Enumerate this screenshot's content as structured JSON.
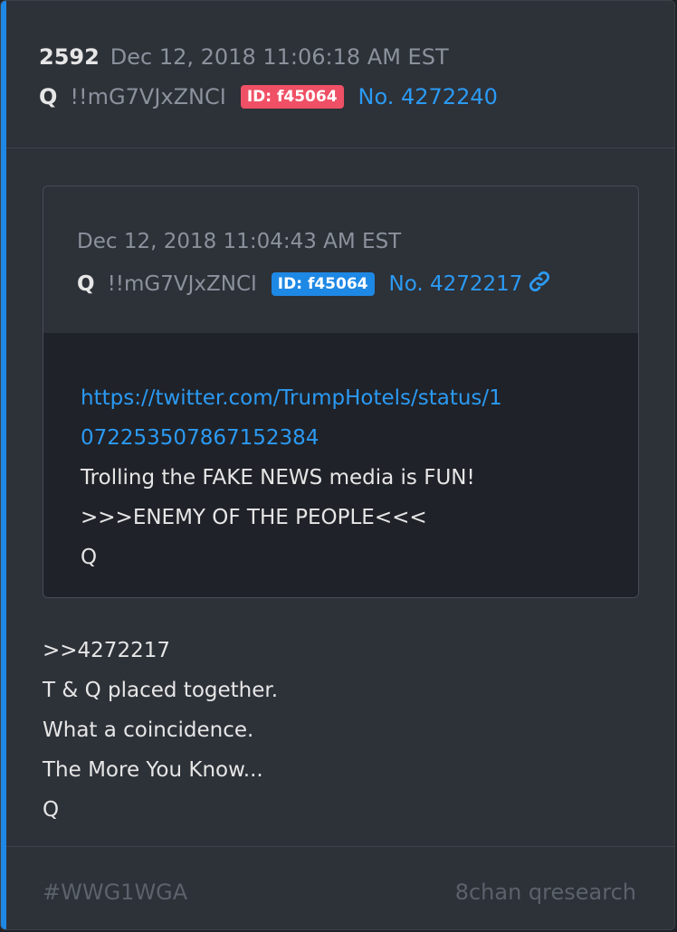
{
  "post": {
    "number": "2592",
    "date": "Dec 12, 2018 11:06:18 AM EST",
    "author": "Q",
    "tripcode": "!!mG7VJxZNCI",
    "id_badge": "ID: f45064",
    "post_no": "No. 4272240"
  },
  "quoted": {
    "date": "Dec 12, 2018 11:04:43 AM EST",
    "author": "Q",
    "tripcode": "!!mG7VJxZNCI",
    "id_badge": "ID: f45064",
    "post_no": "No. 4272217",
    "link_icon": "link-icon",
    "url": "https://twitter.com/TrumpHotels/status/1072253507867152384",
    "lines": [
      "Trolling the FAKE NEWS media is FUN!",
      ">>>ENEMY OF THE PEOPLE<<<",
      "Q"
    ]
  },
  "body_lines": [
    ">>4272217",
    "T & Q placed together.",
    "What a coincidence.",
    "The More You Know...",
    "Q"
  ],
  "footer": {
    "tag": "#WWG1WGA",
    "source": "8chan qresearch"
  },
  "colors": {
    "accent": "#1e88e5",
    "badge_red": "#ef5065",
    "badge_blue": "#1e88e5",
    "link": "#2b9af3"
  }
}
